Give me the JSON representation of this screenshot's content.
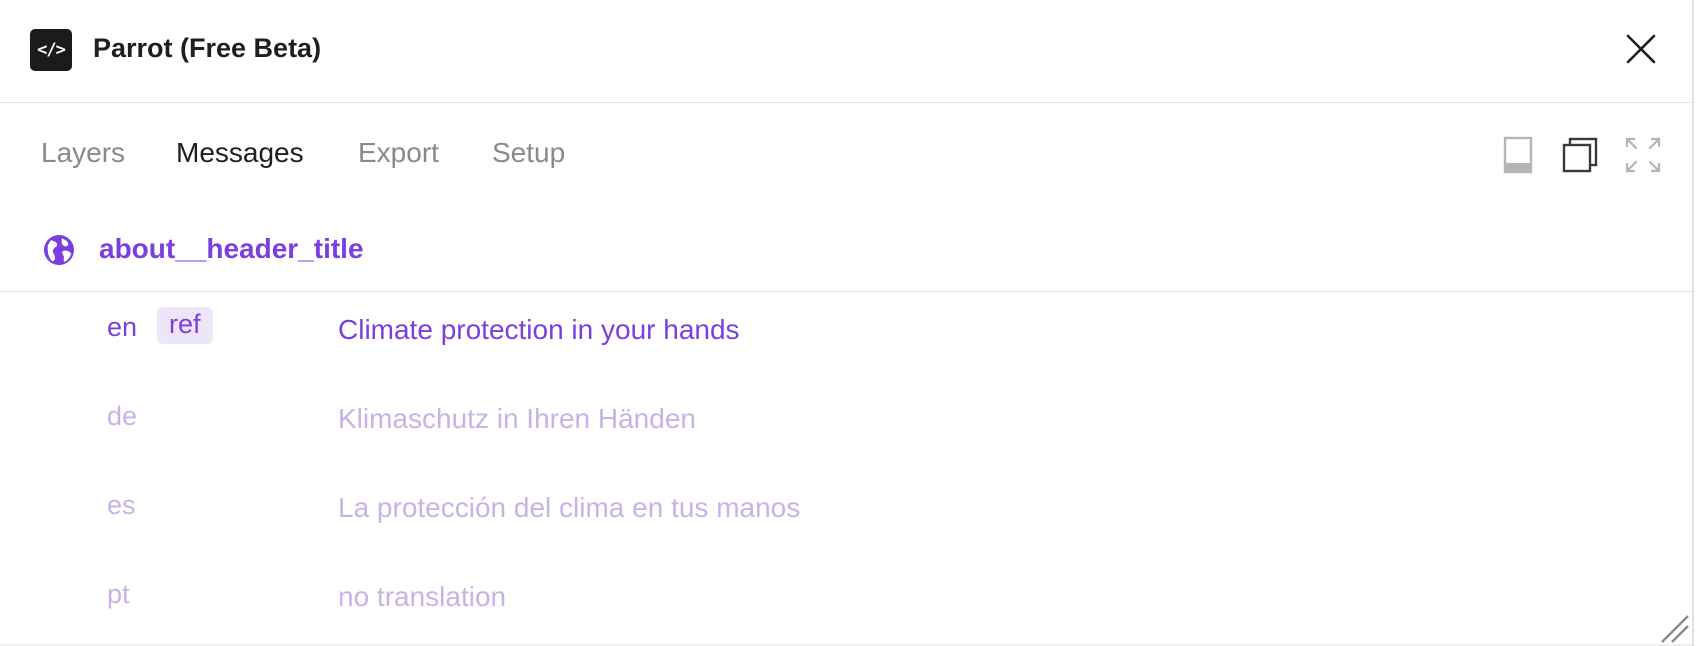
{
  "app": {
    "icon_text": "</>",
    "title": "Parrot (Free Beta)"
  },
  "tabs": [
    {
      "label": "Layers",
      "active": false
    },
    {
      "label": "Messages",
      "active": true
    },
    {
      "label": "Export",
      "active": false
    },
    {
      "label": "Setup",
      "active": false
    }
  ],
  "view_controls": [
    "panel-view-icon",
    "window-view-icon",
    "fullscreen-icon"
  ],
  "message": {
    "key": "about__header_title",
    "translations": [
      {
        "lang": "en",
        "badge": "ref",
        "value": "Climate protection in your hands"
      },
      {
        "lang": "de",
        "value": "Klimaschutz in Ihren Händen"
      },
      {
        "lang": "es",
        "value": "La protección del clima en tus manos"
      },
      {
        "lang": "pt",
        "value": "no translation"
      }
    ]
  },
  "colors": {
    "accent": "#7b3fe0",
    "muted_accent": "#c8b3e4",
    "badge_bg": "#ede5f8",
    "text": "#1f1f1f",
    "inactive_tab": "#8a8a8a"
  }
}
